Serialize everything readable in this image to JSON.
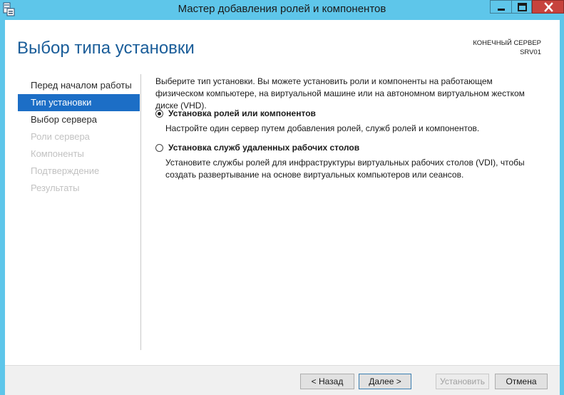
{
  "window": {
    "title": "Мастер добавления ролей и компонентов"
  },
  "page": {
    "title": "Выбор типа установки",
    "target_server_label": "КОНЕЧНЫЙ СЕРВЕР",
    "target_server_name": "SRV01"
  },
  "nav": {
    "items": [
      {
        "label": "Перед началом работы",
        "state": "normal"
      },
      {
        "label": "Тип установки",
        "state": "active"
      },
      {
        "label": "Выбор сервера",
        "state": "normal"
      },
      {
        "label": "Роли сервера",
        "state": "disabled"
      },
      {
        "label": "Компоненты",
        "state": "disabled"
      },
      {
        "label": "Подтверждение",
        "state": "disabled"
      },
      {
        "label": "Результаты",
        "state": "disabled"
      }
    ]
  },
  "content": {
    "intro": "Выберите тип установки. Вы можете установить роли и компоненты на работающем физическом компьютере, на виртуальной машине или на автономном виртуальном жестком диске (VHD).",
    "options": [
      {
        "label": "Установка ролей или компонентов",
        "description": "Настройте один сервер путем добавления ролей, служб ролей и компонентов.",
        "selected": true
      },
      {
        "label": "Установка служб удаленных рабочих столов",
        "description": "Установите службы ролей для инфраструктуры виртуальных рабочих столов (VDI), чтобы создать развертывание на основе виртуальных компьютеров или сеансов.",
        "selected": false
      }
    ]
  },
  "buttons": {
    "back": "< Назад",
    "next": "Далее >",
    "install": "Установить",
    "cancel": "Отмена"
  },
  "colors": {
    "title_bar": "#5ec6ea",
    "close_button": "#c7433d",
    "page_title": "#1a5d99",
    "nav_active": "#1c6ec6"
  }
}
